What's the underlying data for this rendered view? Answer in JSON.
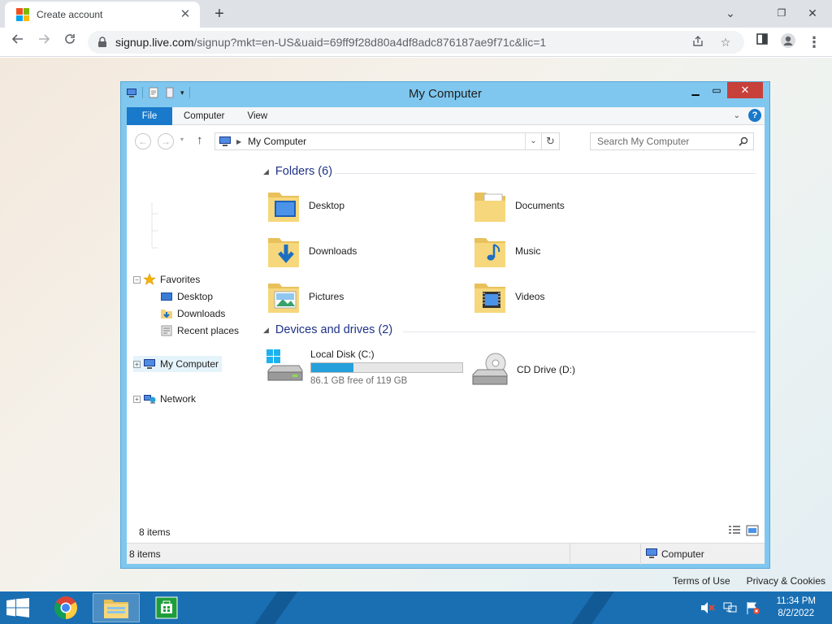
{
  "browser": {
    "tab_title": "Create account",
    "url_host": "signup.live.com",
    "url_rest": "/signup?mkt=en-US&uaid=69ff9f28d80a4df8adc876187ae9f71c&lic=1"
  },
  "page": {
    "footer": {
      "terms": "Terms of Use",
      "privacy": "Privacy & Cookies"
    }
  },
  "explorer": {
    "title": "My Computer",
    "ribbon_tabs": [
      "File",
      "Computer",
      "View"
    ],
    "address": "My Computer",
    "search_placeholder": "Search My Computer",
    "nav": {
      "favorites": "Favorites",
      "desktop": "Desktop",
      "downloads": "Downloads",
      "recent": "Recent places",
      "computer": "My Computer",
      "network": "Network"
    },
    "folders_header": "Folders (6)",
    "folders": [
      "Desktop",
      "Documents",
      "Downloads",
      "Music",
      "Pictures",
      "Videos"
    ],
    "drives_header": "Devices and drives (2)",
    "drives": [
      {
        "name": "Local Disk (C:)",
        "free": "86.1 GB free of 119 GB",
        "used_fraction": 0.28
      },
      {
        "name": "CD Drive (D:)"
      }
    ],
    "items_count": "8 items",
    "status_items": "8 items",
    "status_location": "Computer"
  },
  "taskbar": {
    "time": "11:34 PM",
    "date": "8/2/2022"
  },
  "colors": {
    "ms_red": "#f25022",
    "ms_green": "#7fba00",
    "ms_blue": "#00a4ef",
    "ms_yellow": "#ffb900",
    "window_frame": "#7fc7ef",
    "taskbar": "#1a6fb3",
    "accent": "#1979ca"
  }
}
